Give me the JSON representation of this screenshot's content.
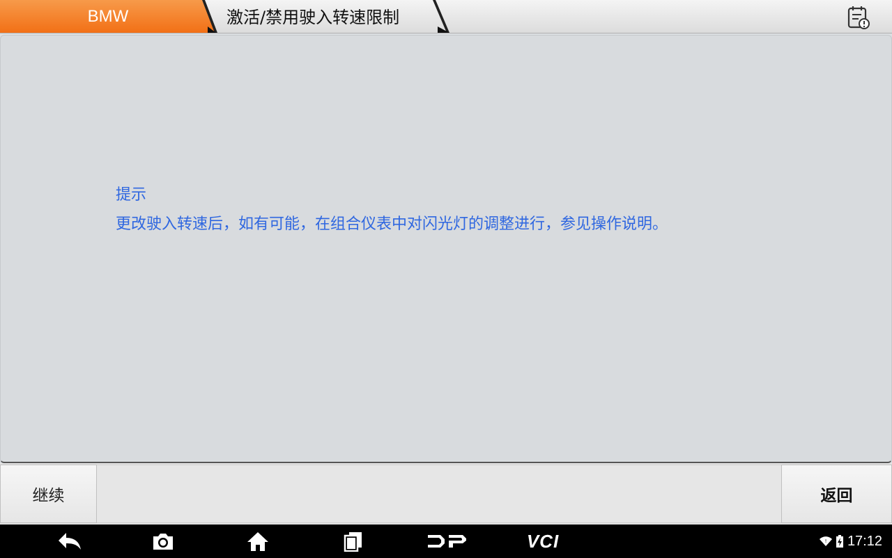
{
  "header": {
    "brand": "BMW",
    "breadcrumb": "激活/禁用驶入转速限制",
    "accent_color": "#f57a20",
    "report_icon": "report-icon"
  },
  "main": {
    "title": "提示",
    "message": "更改驶入转速后，如有可能，在组合仪表中对闪光灯的调整进行，参见操作说明。",
    "text_color": "#2f67e0"
  },
  "actions": {
    "continue_label": "继续",
    "back_label": "返回"
  },
  "navbar": {
    "icons": [
      "back-icon",
      "camera-icon",
      "home-icon",
      "recents-icon",
      "dp-icon",
      "vci-icon"
    ],
    "dp_label": "DP",
    "vci_label": "VCI",
    "time": "17:12"
  }
}
